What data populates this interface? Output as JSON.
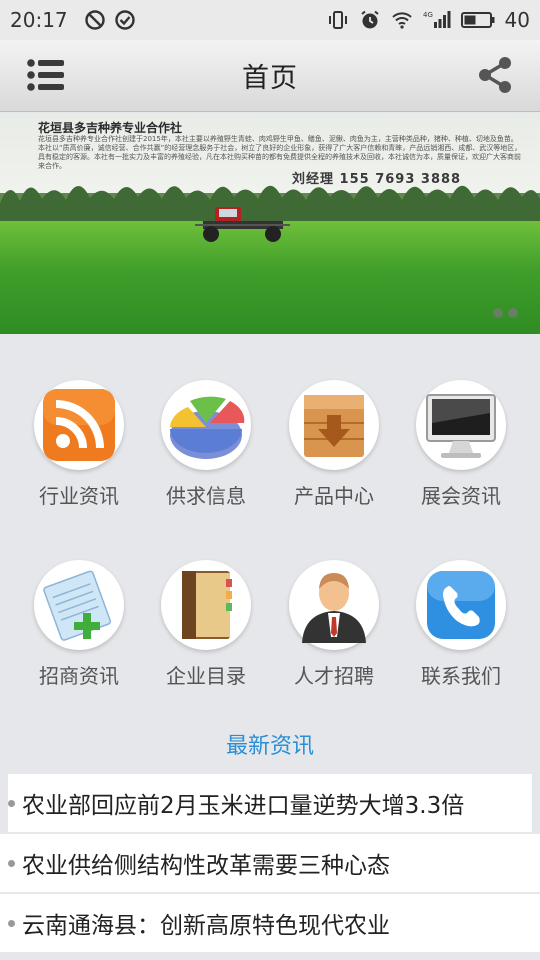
{
  "status_bar": {
    "time": "20:17",
    "battery": "40",
    "icons": [
      "do-not-disturb-icon",
      "check-circle-icon",
      "vibrate-icon",
      "alarm-icon",
      "wifi-icon",
      "4g-signal-icon",
      "battery-icon"
    ]
  },
  "header": {
    "title": "首页",
    "menu_icon": "menu-list-icon",
    "share_icon": "share-icon"
  },
  "banner": {
    "title": "花垣县多吉种养专业合作社",
    "description": "花垣县多吉种养专业合作社创建于2015年，本社主要以养殖野生青蛙、肉鸡野生甲鱼、鳝鱼、泥鳅、肉鱼为主，主营种类品种，猪种、种植、切地及鱼苗。本社以“质高价廉，诚信经营、合作共赢”的经营理念服务于社会，树立了良好的企业形象，获得了广大客户信赖和青睐，产品远销湘西、成都、武汉等地区，具有稳定的客源。本社有一批实力及丰富的养殖经验，凡在本社购买种苗的都有免费提供全程的养殖技术及回收，本社诚信为本，质量保证，欢迎广大客商前来合作。",
    "contact": "刘经理  155 7693 3888",
    "slide_count": 2,
    "active_slide": 1
  },
  "grid": [
    {
      "label": "行业资讯",
      "icon": "rss-feed-icon"
    },
    {
      "label": "供求信息",
      "icon": "pie-chart-icon"
    },
    {
      "label": "产品中心",
      "icon": "product-box-icon"
    },
    {
      "label": "展会资讯",
      "icon": "monitor-icon"
    },
    {
      "label": "招商资讯",
      "icon": "notepad-add-icon"
    },
    {
      "label": "企业目录",
      "icon": "directory-book-icon"
    },
    {
      "label": "人才招聘",
      "icon": "person-icon"
    },
    {
      "label": "联系我们",
      "icon": "phone-icon"
    }
  ],
  "news": {
    "heading": "最新资讯",
    "items": [
      {
        "title": "农业部回应前2月玉米进口量逆势大增3.3倍"
      },
      {
        "title": "农业供给侧结构性改革需要三种心态"
      },
      {
        "title": "云南通海县：创新高原特色现代农业"
      }
    ]
  },
  "colors": {
    "accent": "#2a8fd6",
    "background": "#e6e7ea"
  }
}
